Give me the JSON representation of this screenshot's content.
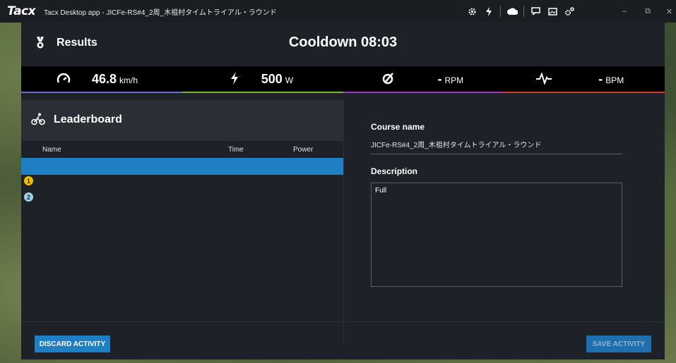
{
  "window": {
    "logo": "Tacx",
    "title": "Tacx Desktop app - JICFe-RS#4_2周_木祖村タイムトライアル・ラウンド",
    "controls": {
      "minimize": "–",
      "restore": "⧉",
      "close": "✕"
    }
  },
  "header": {
    "section": "Results",
    "status": "Cooldown 08:03"
  },
  "metrics": [
    {
      "icon": "speedometer-icon",
      "value": "46.8",
      "unit": "km/h",
      "accent": "#6a6fd8"
    },
    {
      "icon": "power-bolt-icon",
      "value": "500",
      "unit": "W",
      "accent": "#7ab63a"
    },
    {
      "icon": "cadence-icon",
      "value": "-",
      "unit": "RPM",
      "accent": "#a23fbf"
    },
    {
      "icon": "heartrate-icon",
      "value": "-",
      "unit": "BPM",
      "accent": "#d23a3a"
    }
  ],
  "leaderboard": {
    "title": "Leaderboard",
    "columns": {
      "name": "Name",
      "time": "Time",
      "power": "Power"
    },
    "ranks": [
      "1",
      "2"
    ]
  },
  "course": {
    "name_label": "Course name",
    "name_value": "JICFe-RS#4_2周_木祖村タイムトライアル・ラウンド",
    "description_label": "Description",
    "description_value": "Full"
  },
  "footer": {
    "discard_label": "DISCARD ACTIVITY",
    "save_label": "SAVE ACTIVITY"
  },
  "colors": {
    "primary_blue": "#1f7fc4",
    "panel_bg": "#1e2228",
    "rank1": "#f2c200",
    "rank2": "#9fd0ea"
  }
}
